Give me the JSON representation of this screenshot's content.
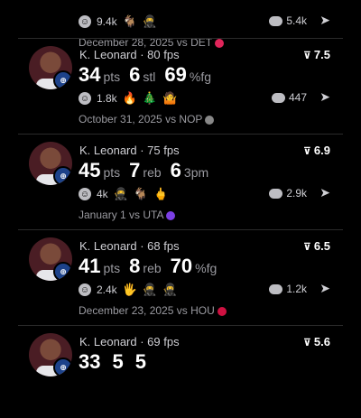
{
  "cards": [
    {
      "player": "",
      "fps": "",
      "score": "",
      "stats": [],
      "reactions_count": "9.4k",
      "emojis": [
        "🐐",
        "🥷"
      ],
      "comments": "5.4k",
      "date": "December 28, 2025 vs DET",
      "team_color": "#e0255a"
    },
    {
      "player": "K. Leonard",
      "fps": "80 fps",
      "score": "7.5",
      "stats": [
        {
          "num": "34",
          "unit": "pts"
        },
        {
          "num": "6",
          "unit": "stl"
        },
        {
          "num": "69",
          "unit": "%fg"
        }
      ],
      "reactions_count": "1.8k",
      "emojis": [
        "🔥",
        "🎄",
        "🤷"
      ],
      "comments": "447",
      "date": "October 31, 2025 vs NOP",
      "team_color": "#888888"
    },
    {
      "player": "K. Leonard",
      "fps": "75 fps",
      "score": "6.9",
      "stats": [
        {
          "num": "45",
          "unit": "pts"
        },
        {
          "num": "7",
          "unit": "reb"
        },
        {
          "num": "6",
          "unit": "3pm"
        }
      ],
      "reactions_count": "4k",
      "emojis": [
        "🥷",
        "🐐",
        "🖕"
      ],
      "comments": "2.9k",
      "date": "January 1 vs UTA",
      "team_color": "#7b3fe4"
    },
    {
      "player": "K. Leonard",
      "fps": "68 fps",
      "score": "6.5",
      "stats": [
        {
          "num": "41",
          "unit": "pts"
        },
        {
          "num": "8",
          "unit": "reb"
        },
        {
          "num": "70",
          "unit": "%fg"
        }
      ],
      "reactions_count": "2.4k",
      "emojis": [
        "🖐",
        "🥷",
        "🥷"
      ],
      "comments": "1.2k",
      "date": "December 23, 2025 vs HOU",
      "team_color": "#ce1141"
    },
    {
      "player": "K. Leonard",
      "fps": "69 fps",
      "score": "5.6",
      "stats": [
        {
          "num": "33",
          "unit": ""
        },
        {
          "num": "5",
          "unit": ""
        },
        {
          "num": "5",
          "unit": ""
        }
      ],
      "reactions_count": "",
      "emojis": [],
      "comments": "",
      "date": "",
      "team_color": ""
    }
  ],
  "icons": {
    "score_arrow": "arrow-icon",
    "reaction": "smiley-icon",
    "comment": "comment-bubble-icon",
    "share": "send-icon",
    "team_badge": "team-badge-icon"
  }
}
